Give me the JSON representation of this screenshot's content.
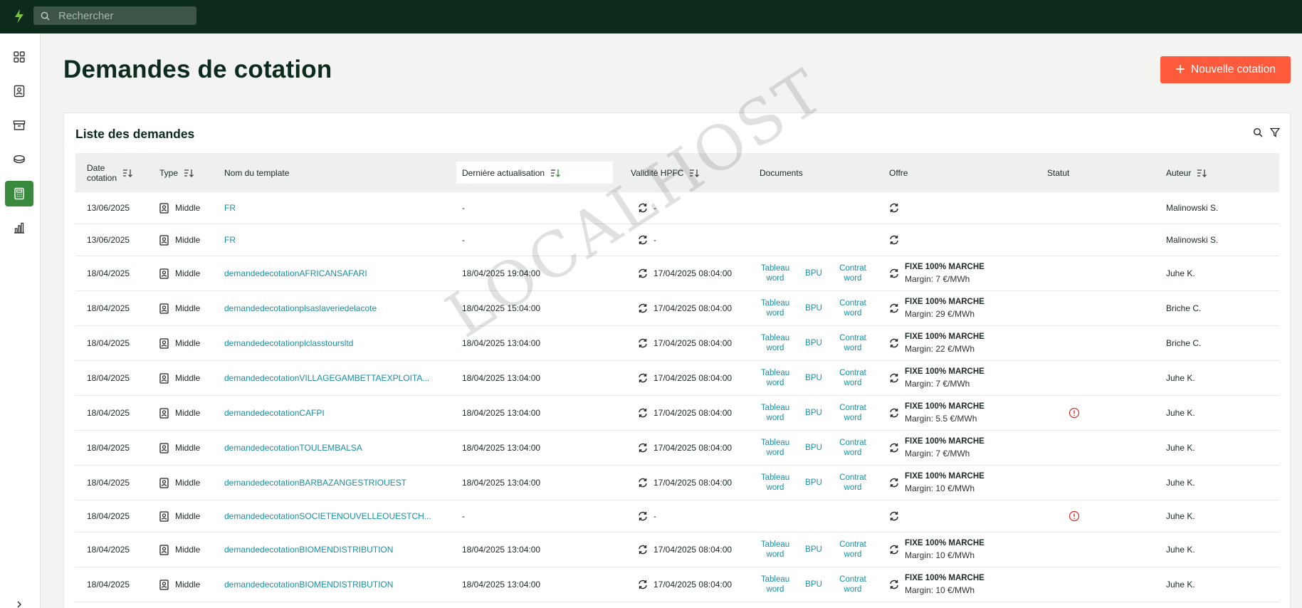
{
  "app": {
    "search_placeholder": "Rechercher",
    "brand_color": "#0d2b1c",
    "accent_color": "#ff5a3c",
    "link_color": "#1a8fa0"
  },
  "sidenav": {
    "items": [
      {
        "icon": "grid-icon",
        "active": false
      },
      {
        "icon": "contact-card-icon",
        "active": false
      },
      {
        "icon": "archive-icon",
        "active": false
      },
      {
        "icon": "coins-icon",
        "active": false
      },
      {
        "icon": "calculator-icon",
        "active": true
      },
      {
        "icon": "bar-chart-icon",
        "active": false
      }
    ]
  },
  "page": {
    "title": "Demandes de cotation",
    "new_button": "Nouvelle cotation"
  },
  "card": {
    "title": "Liste des demandes"
  },
  "table": {
    "headers": {
      "date_line1": "Date",
      "date_line2": "cotation",
      "type": "Type",
      "name": "Nom du template",
      "update": "Dernière actualisation",
      "hpfc": "Validité HPFC",
      "documents": "Documents",
      "offer": "Offre",
      "status": "Statut",
      "author": "Auteur"
    },
    "doc_labels": {
      "tableau_1": "Tableau",
      "tableau_2": "word",
      "bpu": "BPU",
      "contrat_1": "Contrat",
      "contrat_2": "word"
    },
    "rows": [
      {
        "date": "13/06/2025",
        "type": "Middle",
        "name": "FR",
        "update": "-",
        "hpfc": "-",
        "docs": false,
        "offer_title": "",
        "offer_margin": "",
        "status_error": false,
        "author": "Malinowski S."
      },
      {
        "date": "13/06/2025",
        "type": "Middle",
        "name": "FR",
        "update": "-",
        "hpfc": "-",
        "docs": false,
        "offer_title": "",
        "offer_margin": "",
        "status_error": false,
        "author": "Malinowski S."
      },
      {
        "date": "18/04/2025",
        "type": "Middle",
        "name": "demandedecotationAFRICANSAFARI",
        "update": "18/04/2025 19:04:00",
        "hpfc": "17/04/2025 08:04:00",
        "docs": true,
        "offer_title": "FIXE 100% MARCHE",
        "offer_margin": "Margin: 7 €/MWh",
        "status_error": false,
        "author": "Juhe K."
      },
      {
        "date": "18/04/2025",
        "type": "Middle",
        "name": "demandedecotationplsaslaveriedelacote",
        "update": "18/04/2025 15:04:00",
        "hpfc": "17/04/2025 08:04:00",
        "docs": true,
        "offer_title": "FIXE 100% MARCHE",
        "offer_margin": "Margin: 29 €/MWh",
        "status_error": false,
        "author": "Briche C."
      },
      {
        "date": "18/04/2025",
        "type": "Middle",
        "name": "demandedecotationplclasstoursltd",
        "update": "18/04/2025 13:04:00",
        "hpfc": "17/04/2025 08:04:00",
        "docs": true,
        "offer_title": "FIXE 100% MARCHE",
        "offer_margin": "Margin: 22 €/MWh",
        "status_error": false,
        "author": "Briche C."
      },
      {
        "date": "18/04/2025",
        "type": "Middle",
        "name": "demandedecotationVILLAGEGAMBETTAEXPLOITA...",
        "update": "18/04/2025 13:04:00",
        "hpfc": "17/04/2025 08:04:00",
        "docs": true,
        "offer_title": "FIXE 100% MARCHE",
        "offer_margin": "Margin: 7 €/MWh",
        "status_error": false,
        "author": "Juhe K."
      },
      {
        "date": "18/04/2025",
        "type": "Middle",
        "name": "demandedecotationCAFPI",
        "update": "18/04/2025 13:04:00",
        "hpfc": "17/04/2025 08:04:00",
        "docs": true,
        "offer_title": "FIXE 100% MARCHE",
        "offer_margin": "Margin: 5.5 €/MWh",
        "status_error": true,
        "author": "Juhe K."
      },
      {
        "date": "18/04/2025",
        "type": "Middle",
        "name": "demandedecotationTOULEMBALSA",
        "update": "18/04/2025 13:04:00",
        "hpfc": "17/04/2025 08:04:00",
        "docs": true,
        "offer_title": "FIXE 100% MARCHE",
        "offer_margin": "Margin: 7 €/MWh",
        "status_error": false,
        "author": "Juhe K."
      },
      {
        "date": "18/04/2025",
        "type": "Middle",
        "name": "demandedecotationBARBAZANGESTRIOUEST",
        "update": "18/04/2025 13:04:00",
        "hpfc": "17/04/2025 08:04:00",
        "docs": true,
        "offer_title": "FIXE 100% MARCHE",
        "offer_margin": "Margin: 10 €/MWh",
        "status_error": false,
        "author": "Juhe K."
      },
      {
        "date": "18/04/2025",
        "type": "Middle",
        "name": "demandedecotationSOCIETENOUVELLEOUESTCH...",
        "update": "-",
        "hpfc": "-",
        "docs": false,
        "offer_title": "",
        "offer_margin": "",
        "status_error": true,
        "author": "Juhe K."
      },
      {
        "date": "18/04/2025",
        "type": "Middle",
        "name": "demandedecotationBIOMENDISTRIBUTION",
        "update": "18/04/2025 13:04:00",
        "hpfc": "17/04/2025 08:04:00",
        "docs": true,
        "offer_title": "FIXE 100% MARCHE",
        "offer_margin": "Margin: 10 €/MWh",
        "status_error": false,
        "author": "Juhe K."
      },
      {
        "date": "18/04/2025",
        "type": "Middle",
        "name": "demandedecotationBIOMENDISTRIBUTION",
        "update": "18/04/2025 13:04:00",
        "hpfc": "17/04/2025 08:04:00",
        "docs": true,
        "offer_title": "FIXE 100% MARCHE",
        "offer_margin": "Margin: 10 €/MWh",
        "status_error": false,
        "author": "Juhe K."
      }
    ]
  },
  "watermark": "LOCALHOST"
}
